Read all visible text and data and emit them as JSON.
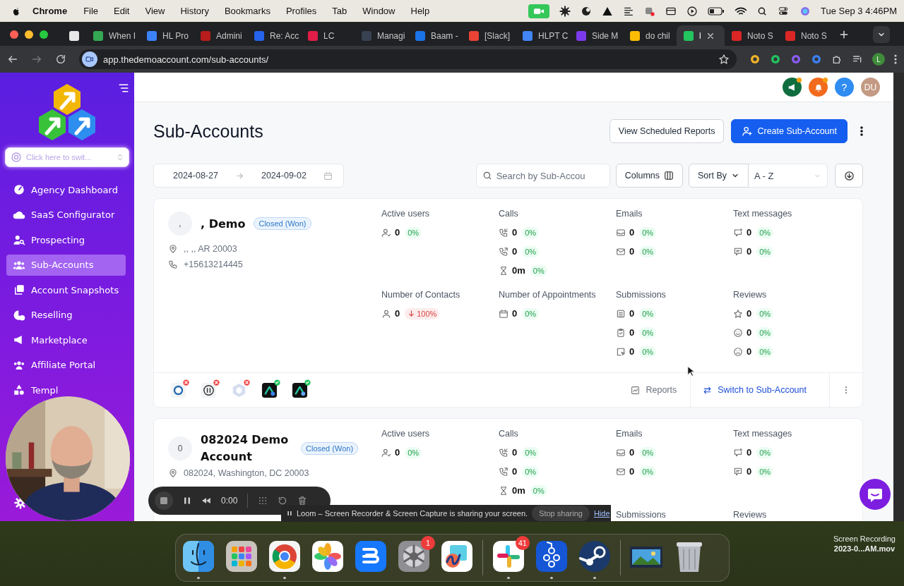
{
  "menubar": {
    "app": "Chrome",
    "menus": [
      "File",
      "Edit",
      "View",
      "History",
      "Bookmarks",
      "Profiles",
      "Tab",
      "Window",
      "Help"
    ],
    "clock": "Tue Sep 3  4:46PM"
  },
  "browser": {
    "tabs": [
      {
        "color": "#e8e8e8",
        "selected": false
      },
      {
        "title": "When I",
        "color": "#34a853",
        "selected": false
      },
      {
        "title": "HL Pro",
        "color": "#3b82f6",
        "selected": false
      },
      {
        "title": "Admini",
        "color": "#b91c1c",
        "selected": false
      },
      {
        "title": "Re: Acc",
        "color": "#2563eb",
        "selected": false
      },
      {
        "title": "LC",
        "color": "#e11d48",
        "selected": false
      },
      {
        "title": "Managi",
        "color": "#374151",
        "selected": false
      },
      {
        "title": "Baam -",
        "color": "#1a73e8",
        "selected": false
      },
      {
        "title": "[Slack]",
        "color": "#ea4335",
        "selected": false
      },
      {
        "title": "HLPT C",
        "color": "#4285f4",
        "selected": false
      },
      {
        "title": "Side M",
        "color": "#7c3aed",
        "selected": false
      },
      {
        "title": "do chil",
        "color": "#fbbc05",
        "selected": false
      },
      {
        "title": "l",
        "color": "#22c55e",
        "selected": true
      },
      {
        "title": "Noto S",
        "color": "#dc2626",
        "selected": false
      },
      {
        "title": "Noto S",
        "color": "#dc2626",
        "selected": false
      }
    ],
    "url": "app.thedemoaccount.com/sub-accounts/",
    "profile": "L"
  },
  "sidebar": {
    "switcher": {
      "placeholder": "Click here to swit..."
    },
    "items": [
      {
        "label": "Agency Dashboard",
        "selected": false
      },
      {
        "label": "SaaS Configurator",
        "selected": false
      },
      {
        "label": "Prospecting",
        "selected": false
      },
      {
        "label": "Sub-Accounts",
        "selected": true
      },
      {
        "label": "Account Snapshots",
        "selected": false
      },
      {
        "label": "Reselling",
        "selected": false
      },
      {
        "label": "Marketplace",
        "selected": false
      },
      {
        "label": "Affiliate Portal",
        "selected": false
      },
      {
        "label": "Templ",
        "selected": false
      }
    ]
  },
  "header": {
    "help": "?",
    "avatar": "DU"
  },
  "page": {
    "title": "Sub-Accounts",
    "scheduled_button": "View Scheduled Reports",
    "create_button": "Create Sub-Account",
    "date_start": "2024-08-27",
    "date_end": "2024-09-02",
    "search": {
      "placeholder": "Search by Sub-Accou"
    },
    "columns_button": "Columns",
    "sort_label": "Sort By",
    "sort_value": "A - Z"
  },
  "accounts": [
    {
      "avatar": ",",
      "name": ", Demo",
      "status": "Closed (Won)",
      "address": ",, ,, AR 20003",
      "phone": "+15613214445",
      "metrics": [
        {
          "kind": "users",
          "title": "Active users",
          "rows": [
            {
              "value": "0",
              "change": "0%",
              "decrease": false
            }
          ]
        },
        {
          "kind": "calls",
          "title": "Calls",
          "rows": [
            {
              "value": "0",
              "change": "0%",
              "decrease": false
            },
            {
              "value": "0",
              "change": "0%",
              "decrease": false
            },
            {
              "value": "0m",
              "change": "0%",
              "decrease": false
            }
          ]
        },
        {
          "kind": "emails",
          "title": "Emails",
          "rows": [
            {
              "value": "0",
              "change": "0%",
              "decrease": false
            },
            {
              "value": "0",
              "change": "0%",
              "decrease": false
            }
          ]
        },
        {
          "kind": "texts",
          "title": "Text messages",
          "rows": [
            {
              "value": "0",
              "change": "0%",
              "decrease": false
            },
            {
              "value": "0",
              "change": "0%",
              "decrease": false
            }
          ]
        },
        {
          "kind": "contacts",
          "title": "Number of Contacts",
          "rows": [
            {
              "value": "0",
              "change": "100%",
              "decrease": true
            }
          ]
        },
        {
          "kind": "appointments",
          "title": "Number of Appointments",
          "rows": [
            {
              "value": "0",
              "change": "0%",
              "decrease": false
            }
          ]
        },
        {
          "kind": "submissions",
          "title": "Submissions",
          "rows": [
            {
              "value": "0",
              "change": "0%",
              "decrease": false
            },
            {
              "value": "0",
              "change": "0%",
              "decrease": false
            },
            {
              "value": "0",
              "change": "0%",
              "decrease": false
            }
          ]
        },
        {
          "kind": "reviews",
          "title": "Reviews",
          "rows": [
            {
              "value": "0",
              "change": "0%",
              "decrease": false
            },
            {
              "value": "0",
              "change": "0%",
              "decrease": false
            },
            {
              "value": "0",
              "change": "0%",
              "decrease": false
            }
          ]
        }
      ],
      "integrations": [
        {
          "connected": false
        },
        {
          "connected": false
        },
        {
          "connected": false
        },
        {
          "connected": true
        },
        {
          "connected": true
        }
      ],
      "reports_link": "Reports",
      "switch_button": "Switch to Sub-Account"
    },
    {
      "avatar": "0",
      "name": "082024 Demo Account",
      "status": "Closed (Won)",
      "address": "082024, Washington, DC 20003",
      "metrics": [
        {
          "kind": "users",
          "title": "Active users",
          "rows": [
            {
              "value": "0",
              "change": "0%",
              "decrease": false
            }
          ]
        },
        {
          "kind": "calls",
          "title": "Calls",
          "rows": [
            {
              "value": "0",
              "change": "0%",
              "decrease": false
            },
            {
              "value": "0",
              "change": "0%",
              "decrease": false
            },
            {
              "value": "0m",
              "change": "0%",
              "decrease": false
            }
          ]
        },
        {
          "kind": "emails",
          "title": "Emails",
          "rows": [
            {
              "value": "0",
              "change": "0%",
              "decrease": false
            },
            {
              "value": "0",
              "change": "0%",
              "decrease": false
            }
          ]
        },
        {
          "kind": "texts",
          "title": "Text messages",
          "rows": [
            {
              "value": "0",
              "change": "0%",
              "decrease": false
            },
            {
              "value": "0",
              "change": "0%",
              "decrease": false
            }
          ]
        },
        {
          "kind": "submissions",
          "title": "Submissions"
        },
        {
          "kind": "reviews",
          "title": "Reviews"
        }
      ]
    }
  ],
  "recorder": {
    "timer": "0:00"
  },
  "share_banner": {
    "message": "Loom – Screen Recorder & Screen Capture is sharing your screen.",
    "stop_button": "Stop sharing",
    "hide_link": "Hide"
  },
  "dock": {
    "sections": [
      [
        {
          "running": true
        },
        {
          "running": false
        },
        {
          "running": true
        },
        {
          "running": false
        },
        {
          "running": false
        },
        {
          "running": false,
          "badge": "1"
        },
        {
          "running": false
        }
      ],
      [
        {
          "running": true,
          "badge": "41"
        },
        {
          "running": true
        },
        {
          "running": true
        }
      ],
      [
        {
          "running": false
        },
        {
          "running": false
        }
      ]
    ]
  },
  "desktop_file": {
    "lines": [
      "Screen Recording",
      "2023-0...AM.mov"
    ]
  }
}
